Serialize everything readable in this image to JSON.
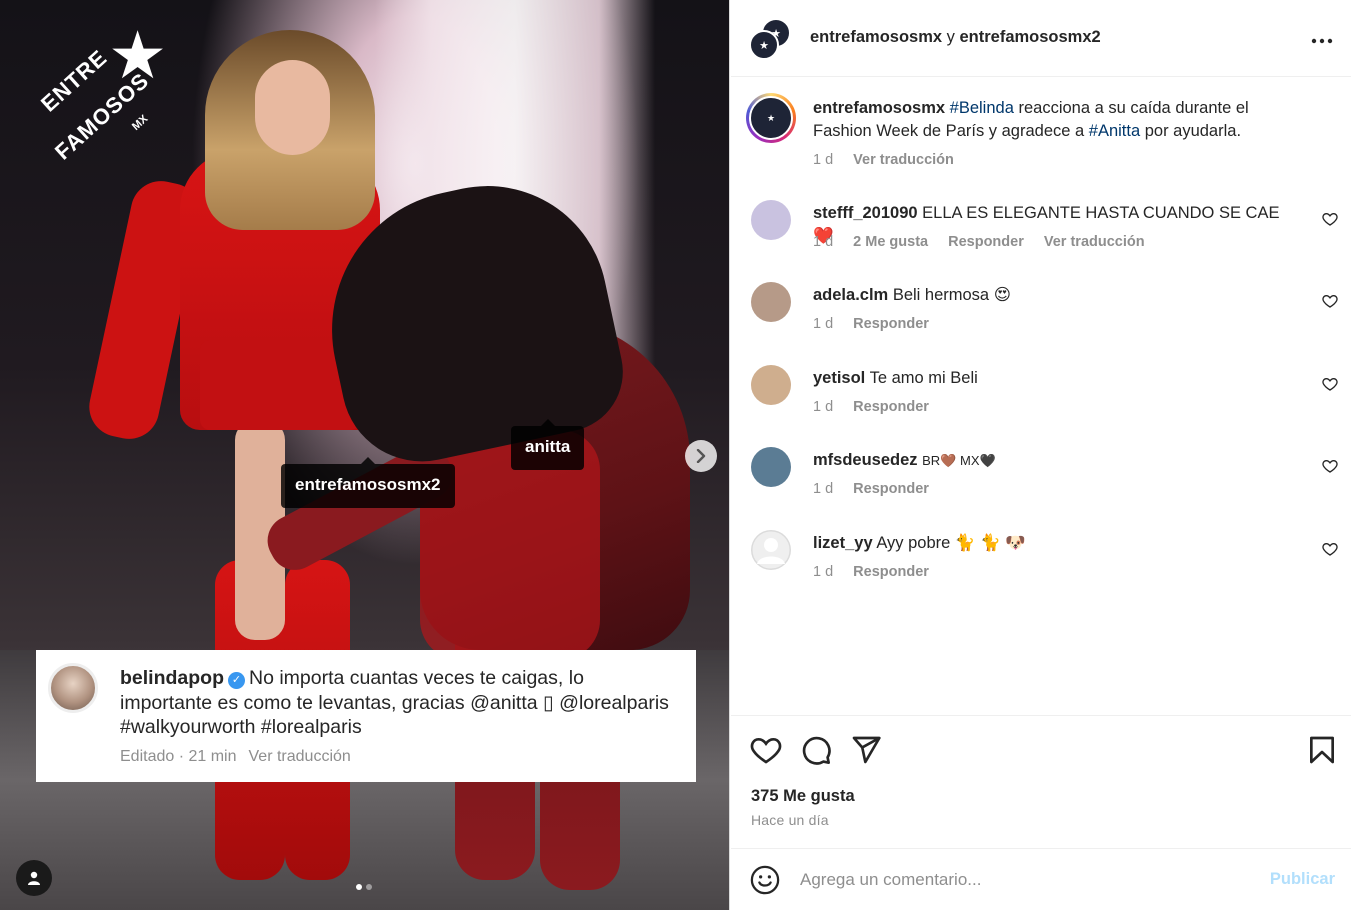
{
  "media": {
    "logo": {
      "line1": "ENTRE",
      "line2": "FAMOSOS",
      "line3": "MX"
    },
    "tags": {
      "anitta": "anitta",
      "entre": "entrefamososmx2"
    },
    "quote": {
      "user": "belindapop",
      "text": "No importa cuantas veces te caigas, lo importante es como te levantas, gracias @anitta ▯ @lorealparis #walkyourworth #lorealparis",
      "meta_edited": "Editado · 21 min",
      "meta_translate": "Ver traducción"
    },
    "carousel": {
      "current": 1,
      "total": 2
    }
  },
  "header": {
    "user1": "entrefamososmx",
    "conj": " y ",
    "user2": "entrefamososmx2"
  },
  "caption": {
    "user": "entrefamososmx",
    "hashtag1": "#Belinda",
    "text1": " reacciona a su caída durante el Fashion Week de París y agradece a ",
    "hashtag2": "#Anitta",
    "text2": " por ayudarla.",
    "age": "1 d",
    "translate": "Ver traducción"
  },
  "comments": [
    {
      "user": "stefff_201090",
      "text": "ELLA ES ELEGANTE HASTA CUANDO SE CAE",
      "emoji": "❤️",
      "age": "1 d",
      "likes": "2 Me gusta",
      "reply": "Responder",
      "translate": "Ver traducción",
      "avatar_color": "#c9c2e0"
    },
    {
      "user": "adela.clm",
      "text": "Beli hermosa",
      "emoji": "😍",
      "age": "1 d",
      "reply": "Responder",
      "avatar_color": "#b69a88"
    },
    {
      "user": "yetisol",
      "text": "Te amo mi Beli",
      "emoji": "",
      "age": "1 d",
      "reply": "Responder",
      "avatar_color": "#cfae8e"
    },
    {
      "user": "mfsdeusedez",
      "text": "BR🤎 MX🖤",
      "emoji": "",
      "age": "1 d",
      "reply": "Responder",
      "avatar_color": "#5b7c94"
    },
    {
      "user": "lizet_yy",
      "text": "Ayy pobre",
      "emoji": "🐈 🐈 🐶",
      "age": "1 d",
      "reply": "Responder",
      "avatar_color": "#dbdbdb"
    }
  ],
  "actions": {
    "likes": "375 Me gusta",
    "time": "Hace un día"
  },
  "comment_box": {
    "placeholder": "Agrega un comentario...",
    "publish": "Publicar"
  }
}
